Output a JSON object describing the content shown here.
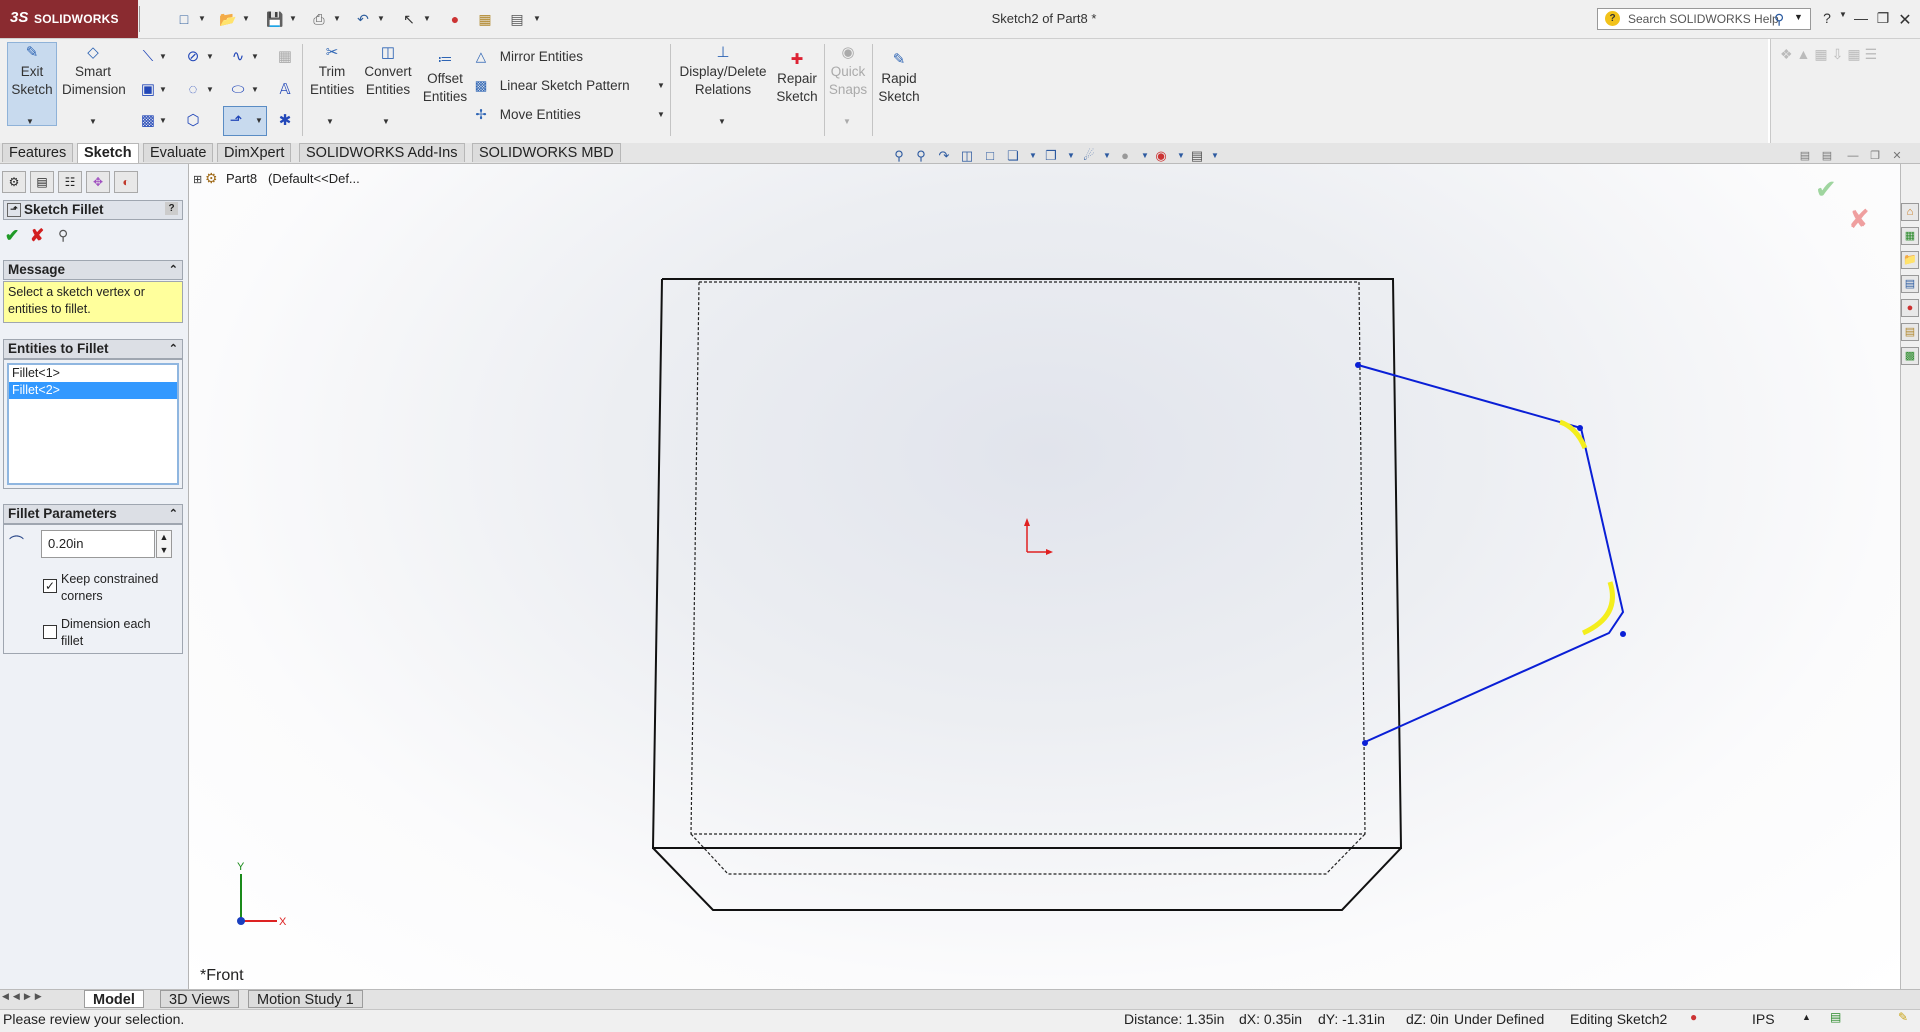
{
  "app": {
    "brand": "SOLIDWORKS",
    "doc_title": "Sketch2 of Part8 *"
  },
  "search": {
    "placeholder": "Search SOLIDWORKS Help"
  },
  "toolbar": {
    "exit_sketch": [
      "Exit",
      "Sketch"
    ],
    "smart_dimension": [
      "Smart",
      "Dimension"
    ],
    "trim_entities": [
      "Trim",
      "Entities"
    ],
    "convert_entities": [
      "Convert",
      "Entities"
    ],
    "offset_entities": [
      "Offset",
      "Entities"
    ],
    "mirror_entities": "Mirror Entities",
    "linear_sketch_pattern": "Linear Sketch Pattern",
    "move_entities": "Move Entities",
    "display_delete_relations": [
      "Display/Delete",
      "Relations"
    ],
    "repair_sketch": [
      "Repair",
      "Sketch"
    ],
    "quick_snaps": [
      "Quick",
      "Snaps"
    ],
    "rapid_sketch": [
      "Rapid",
      "Sketch"
    ]
  },
  "tabs": [
    "Features",
    "Sketch",
    "Evaluate",
    "DimXpert",
    "SOLIDWORKS Add-Ins",
    "SOLIDWORKS MBD"
  ],
  "active_tab": "Sketch",
  "property_manager": {
    "title": "Sketch Fillet",
    "message_header": "Message",
    "message_line1": "Select a sketch vertex or",
    "message_line2": "entities to fillet.",
    "entities_header": "Entities to Fillet",
    "entities": [
      "Fillet<1>",
      "Fillet<2>"
    ],
    "selected_entity": "Fillet<2>",
    "params_header": "Fillet Parameters",
    "radius": "0.20in",
    "keep_constrained_1": "Keep constrained",
    "keep_constrained_2": "corners",
    "keep_constrained_checked": true,
    "dimension_each_1": "Dimension each",
    "dimension_each_2": "fillet",
    "dimension_each_checked": false
  },
  "feature_tree": {
    "part": "Part8",
    "config": "(Default<<Def..."
  },
  "viewport": {
    "view_label": "*Front",
    "axis_x": "X",
    "axis_y": "Y"
  },
  "bottom_tabs": [
    "Model",
    "3D Views",
    "Motion Study 1"
  ],
  "status_bar": {
    "message": "Please review your selection.",
    "distance": "Distance: 1.35in",
    "dx": "dX: 0.35in",
    "dy": "dY: -1.31in",
    "dz": "dZ: 0in",
    "sketch_state": "Under Defined",
    "editing": "Editing Sketch2",
    "units": "IPS"
  },
  "colors": {
    "brand": "#8a2b30",
    "sketch_line": "#0a1fd6",
    "highlight": "#f4ee1c",
    "origin": "#e02020",
    "selection": "#3399ff"
  }
}
